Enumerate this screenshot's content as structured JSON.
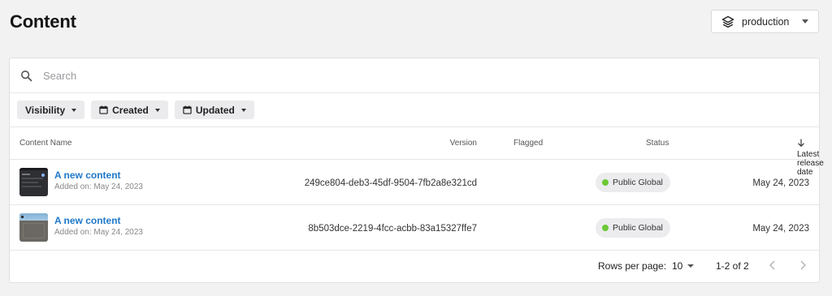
{
  "page": {
    "title": "Content"
  },
  "environment": {
    "selected": "production"
  },
  "search": {
    "placeholder": "Search"
  },
  "filters": [
    {
      "label": "Visibility",
      "icon": "none"
    },
    {
      "label": "Created",
      "icon": "calendar-icon"
    },
    {
      "label": "Updated",
      "icon": "calendar-icon"
    }
  ],
  "table": {
    "columns": {
      "name": "Content Name",
      "version": "Version",
      "flagged": "Flagged",
      "status": "Status",
      "latest": "Latest release date"
    },
    "sort": {
      "column": "Latest release date",
      "direction": "descending"
    },
    "rows": [
      {
        "name": "A new content",
        "added": "Added on: May 24, 2023",
        "version": "249ce804-deb3-45df-9504-7fb2a8e321cd",
        "flagged": "",
        "status": "Public Global",
        "latest": "May 24, 2023"
      },
      {
        "name": "A new content",
        "added": "Added on: May 24, 2023",
        "version": "8b503dce-2219-4fcc-acbb-83a15327ffe7",
        "flagged": "",
        "status": "Public Global",
        "latest": "May 24, 2023"
      }
    ]
  },
  "pagination": {
    "rows_per_page_label": "Rows per page:",
    "rows_per_page": "10",
    "range": "1-2 of 2"
  },
  "colors": {
    "link": "#1f78c9",
    "status_green": "#6cc836",
    "background": "#f2f2f3"
  }
}
